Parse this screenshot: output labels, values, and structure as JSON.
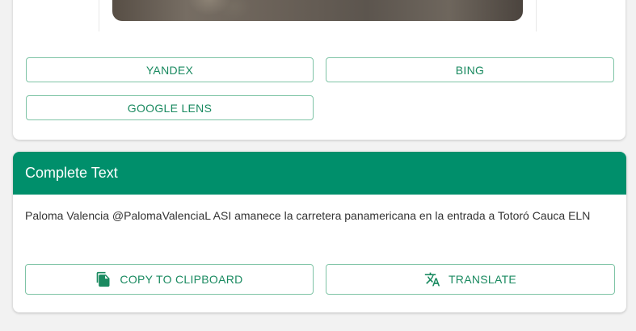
{
  "search_buttons": {
    "yandex": "YANDEX",
    "bing": "BING",
    "google_lens": "GOOGLE LENS"
  },
  "complete_text": {
    "title": "Complete Text",
    "body": "Paloma Valencia @PalomaValenciaL ASI amanece la carretera panamericana en la entrada a Totoró Cauca ELN",
    "copy_label": "COPY TO CLIPBOARD",
    "translate_label": "TRANSLATE"
  },
  "icons": {
    "copy": "content-copy-icon",
    "translate": "translate-icon"
  },
  "colors": {
    "accent": "#008f6b",
    "button_text": "#1a8a60",
    "button_border": "#7fc4a6",
    "background": "#f2f2f2"
  }
}
